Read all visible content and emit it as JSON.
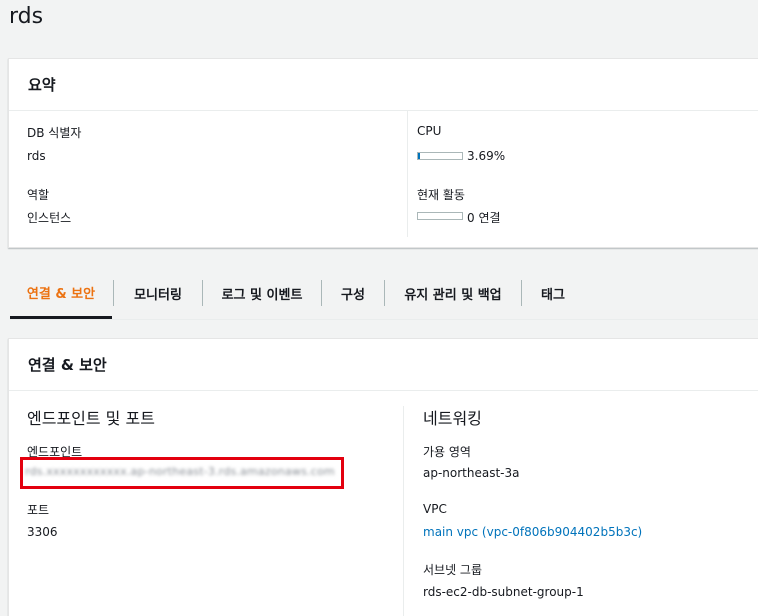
{
  "page": {
    "title": "rds"
  },
  "summary": {
    "header": "요약",
    "db_identifier_label": "DB 식별자",
    "db_identifier_value": "rds",
    "role_label": "역할",
    "role_value": "인스턴스",
    "cpu_label": "CPU",
    "cpu_value": "3.69%",
    "cpu_fraction": 0.0369,
    "activity_label": "현재 활동",
    "activity_value": "0 연결",
    "activity_fraction": 0
  },
  "tabs": [
    {
      "label": "연결 & 보안",
      "active": true
    },
    {
      "label": "모니터링",
      "active": false
    },
    {
      "label": "로그 및 이벤트",
      "active": false
    },
    {
      "label": "구성",
      "active": false
    },
    {
      "label": "유지 관리 및 백업",
      "active": false
    },
    {
      "label": "태그",
      "active": false
    }
  ],
  "connectivity": {
    "header": "연결 & 보안",
    "endpoint_section": "엔드포인트 및 포트",
    "endpoint_label": "엔드포인트",
    "endpoint_value": "rds.xxxxxxxxxxxx.ap-northeast-3.rds.amazonaws.com",
    "port_label": "포트",
    "port_value": "3306",
    "network_section": "네트워킹",
    "az_label": "가용 영역",
    "az_value": "ap-northeast-3a",
    "vpc_label": "VPC",
    "vpc_value": "main vpc (vpc-0f806b904402b5b3c)",
    "subnet_group_label": "서브넷 그룹",
    "subnet_group_value": "rds-ec2-db-subnet-group-1"
  },
  "colors": {
    "accent": "#ec7211",
    "link": "#0073bb",
    "highlight": "#e3000f"
  }
}
